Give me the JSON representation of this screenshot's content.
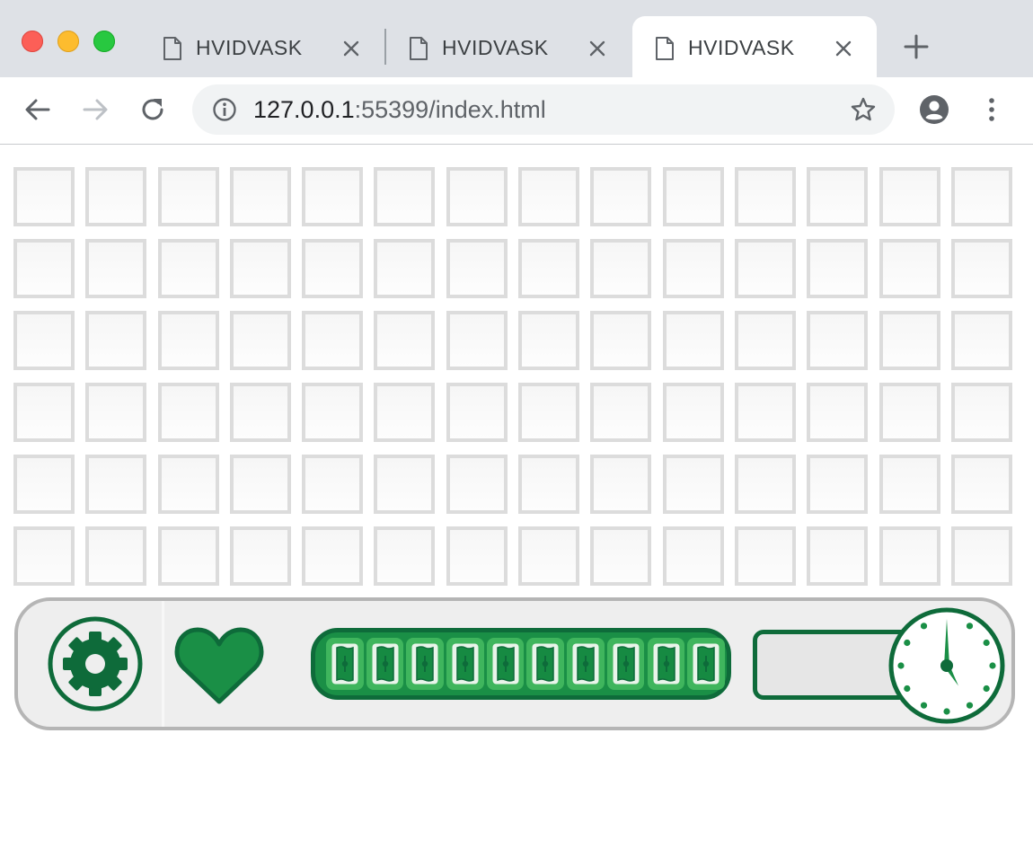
{
  "browser": {
    "tabs": [
      {
        "title": "HVIDVASK",
        "active": false
      },
      {
        "title": "HVIDVASK",
        "active": false
      },
      {
        "title": "HVIDVASK",
        "active": true
      }
    ],
    "address": {
      "host": "127.0.0.1",
      "rest": ":55399/index.html"
    }
  },
  "game": {
    "grid": {
      "rows": 6,
      "columns": 14
    },
    "money_bar": {
      "bills": 10
    },
    "clock": {
      "hour": 5,
      "minute": 0
    }
  },
  "colors": {
    "accent_dark": "#0e6b3a",
    "accent": "#1a8f46",
    "accent_light": "#3fb55d",
    "cell_border": "#dcdcdc",
    "hud_border": "#b5b5b5"
  },
  "icons": {
    "settings": "gear-icon",
    "health": "heart-icon",
    "money": "banknote-icon",
    "time": "clock-icon"
  }
}
